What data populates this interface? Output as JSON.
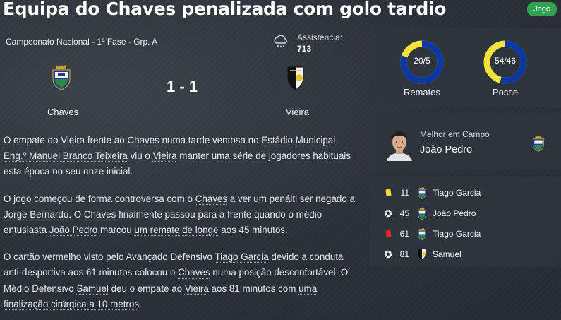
{
  "headline": "Equipa do Chaves penalizada com golo tardio",
  "tag": "Jogo",
  "match": {
    "competition": "Campeonato Nacional - 1ª Fase - Grp. A",
    "weather_icon": "cloud-rain-icon",
    "attendance_label": "Assistência:",
    "attendance_value": "713",
    "home_team": "Chaves",
    "away_team": "Vieira",
    "score": "1 - 1"
  },
  "stats": {
    "shots": {
      "text": "20/5",
      "label": "Remates",
      "home": 20,
      "away": 5
    },
    "possession": {
      "text": "54/46",
      "label": "Posse",
      "home": 54,
      "away": 46
    },
    "home_color": "#0b36a8",
    "away_color": "#f2e23a"
  },
  "motm": {
    "title": "Melhor em Campo",
    "name": "João Pedro"
  },
  "events": [
    {
      "icon": "yellow-card-icon",
      "minute": "11",
      "team": "home",
      "player": "Tiago Garcia"
    },
    {
      "icon": "ball-icon",
      "minute": "45",
      "team": "home",
      "player": "João Pedro"
    },
    {
      "icon": "red-card-icon",
      "minute": "61",
      "team": "home",
      "player": "Tiago Garcia"
    },
    {
      "icon": "ball-icon",
      "minute": "81",
      "team": "away",
      "player": "Samuel"
    }
  ],
  "article": {
    "p1": [
      "O empate do ",
      "Vieira",
      " frente ao ",
      "Chaves",
      " numa tarde ventosa no ",
      "Estádio Municipal Eng.º Manuel Branco Teixeira",
      " viu o ",
      "Vieira",
      " manter uma série de jogadores habituais esta época no seu onze inicial."
    ],
    "p2": [
      "O jogo começou de forma controversa com o ",
      "Chaves",
      " a ver um penálti ser negado a ",
      "Jorge Bernardo",
      ". O ",
      "Chaves",
      " finalmente passou para a frente quando o médio entusiasta ",
      "João Pedro",
      " marcou ",
      "um remate de longe",
      " aos 45 minutos."
    ],
    "p3": [
      "O cartão vermelho visto pelo Avançado Defensivo ",
      "Tiago Garcia",
      " devido a conduta anti-desportiva aos 61 minutos colocou o ",
      "Chaves",
      " numa posição desconfortável. O Médio Defensivo ",
      "Samuel",
      " deu o empate ao ",
      "Vieira",
      " aos 81 minutos com ",
      "uma finalização cirúrgica a 10 metros",
      "."
    ]
  }
}
